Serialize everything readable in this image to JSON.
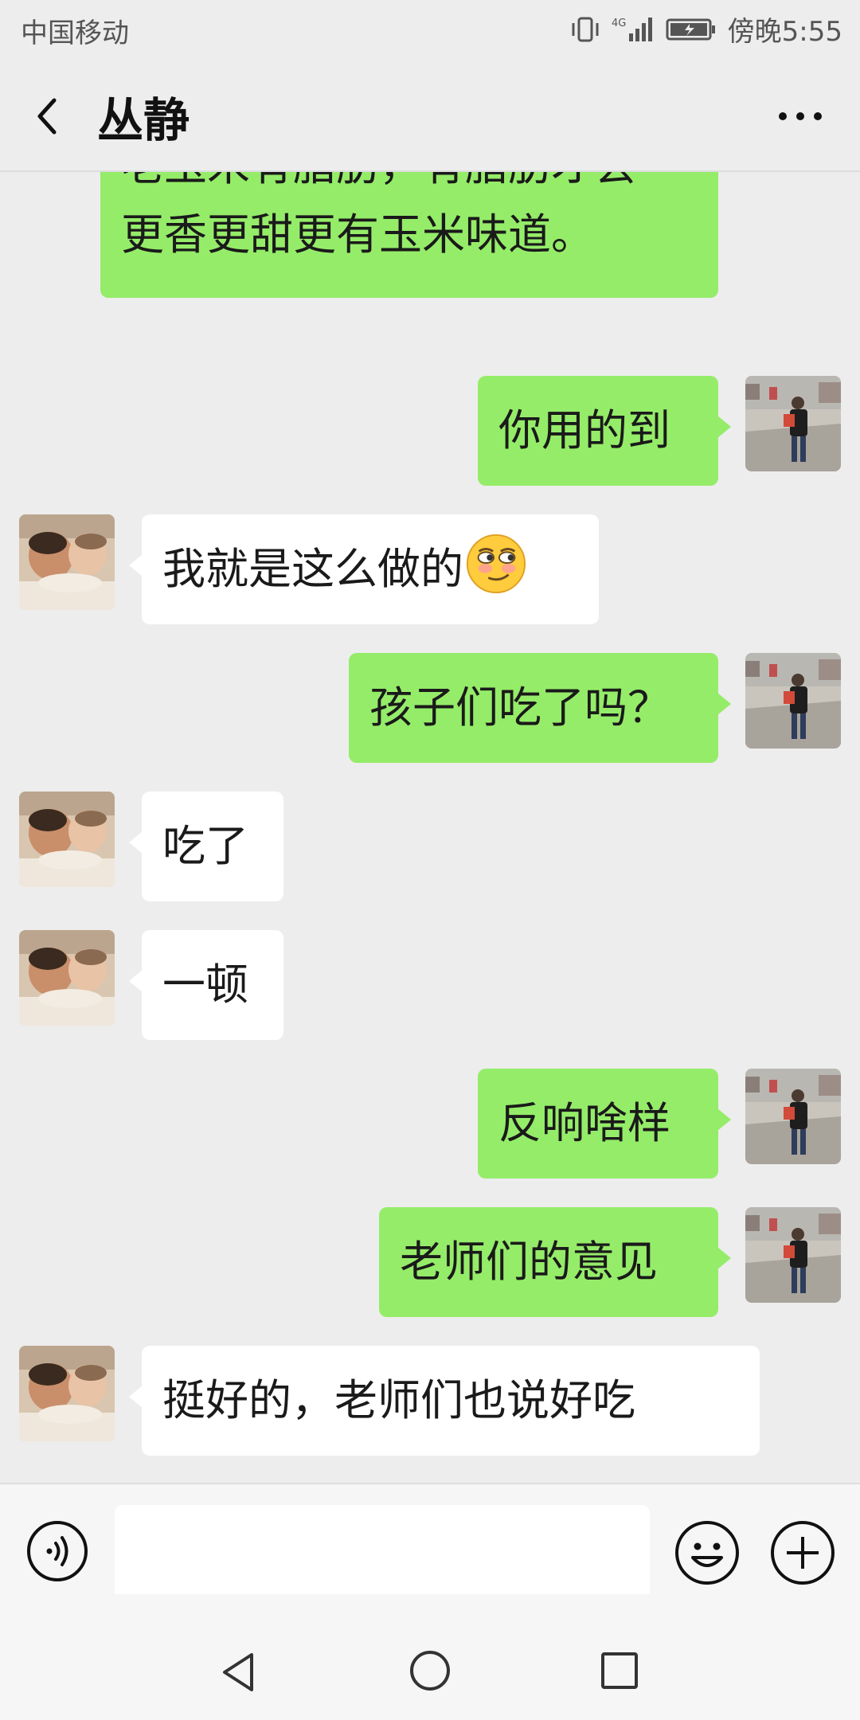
{
  "status_bar": {
    "carrier": "中国移动",
    "network": "4G",
    "time": "傍晚5:55"
  },
  "header": {
    "title": "丛静"
  },
  "messages": [
    {
      "side": "right",
      "text_lines": [
        "老玉米有脂肪，有脂肪才会",
        "更香更甜更有玉米味道。"
      ]
    },
    {
      "side": "right",
      "text": "你用的到"
    },
    {
      "side": "left",
      "text": "我就是这么做的",
      "emoji": "smirk-emoji"
    },
    {
      "side": "right",
      "text": "孩子们吃了吗？"
    },
    {
      "side": "left",
      "text": "吃了"
    },
    {
      "side": "left",
      "text": "一顿"
    },
    {
      "side": "right",
      "text": "反响啥样"
    },
    {
      "side": "right",
      "text": "老师们的意见"
    },
    {
      "side": "left",
      "text": "挺好的，老师们也说好吃"
    }
  ],
  "input_bar": {
    "placeholder": "",
    "icons": [
      "voice-icon",
      "emoji-icon",
      "plus-icon"
    ]
  },
  "nav_bar": {
    "icons": [
      "back-triangle-icon",
      "home-circle-icon",
      "recent-square-icon"
    ]
  },
  "colors": {
    "background": "#ededed",
    "bubble_self": "#95ec69",
    "bubble_other": "#ffffff"
  }
}
